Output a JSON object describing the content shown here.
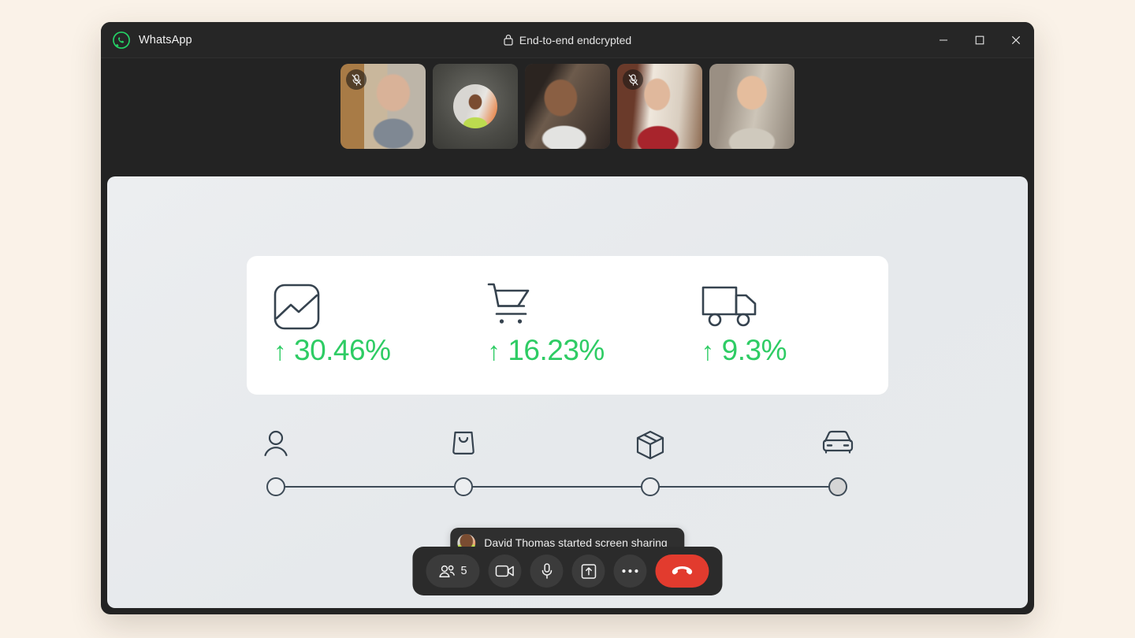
{
  "window": {
    "app_name": "WhatsApp",
    "logo_icon": "whatsapp-logo-icon",
    "encryption_label": "End-to-end endcrypted",
    "lock_icon": "lock-icon",
    "controls": {
      "minimize": "minimize-icon",
      "maximize": "maximize-icon",
      "close": "close-icon"
    }
  },
  "participants": [
    {
      "id": "p1",
      "camera_on": true,
      "muted": true,
      "mute_icon": "mic-off-icon"
    },
    {
      "id": "p2",
      "camera_on": false,
      "muted": false,
      "avatar_name": "David Thomas"
    },
    {
      "id": "p3",
      "camera_on": true,
      "muted": false
    },
    {
      "id": "p4",
      "camera_on": true,
      "muted": true,
      "mute_icon": "mic-off-icon"
    },
    {
      "id": "p5",
      "camera_on": true,
      "muted": false
    }
  ],
  "shared_screen": {
    "stats": [
      {
        "icon": "chart-image-icon",
        "arrow": "↑",
        "value": "30.46%",
        "color": "#2ecc64"
      },
      {
        "icon": "shopping-cart-icon",
        "arrow": "↑",
        "value": "16.23%",
        "color": "#2ecc64"
      },
      {
        "icon": "delivery-truck-icon",
        "arrow": "↑",
        "value": "9.3%",
        "color": "#2ecc64"
      }
    ],
    "stepper": {
      "steps": [
        {
          "icon": "person-icon",
          "position_pct": 0,
          "filled": false
        },
        {
          "icon": "shopping-bag-icon",
          "position_pct": 33.33,
          "filled": false
        },
        {
          "icon": "package-box-icon",
          "position_pct": 66.66,
          "filled": false
        },
        {
          "icon": "car-icon",
          "position_pct": 100,
          "filled": true
        }
      ]
    }
  },
  "toast": {
    "avatar_name": "David Thomas",
    "message": "David Thomas started screen sharing"
  },
  "controls": {
    "participants": {
      "icon": "people-icon",
      "count": "5"
    },
    "video": {
      "icon": "video-camera-icon"
    },
    "mic": {
      "icon": "microphone-icon"
    },
    "share": {
      "icon": "share-screen-icon"
    },
    "more": {
      "icon": "more-dots-icon"
    },
    "end": {
      "icon": "end-call-icon"
    }
  },
  "colors": {
    "page_background": "#faf2e8",
    "window_background": "#232323",
    "titlebar": "#262626",
    "stage": "#eceef0",
    "card": "#ffffff",
    "accent_green": "#2ecc64",
    "end_call_red": "#e23b2e",
    "icon_dark": "#36434f"
  }
}
